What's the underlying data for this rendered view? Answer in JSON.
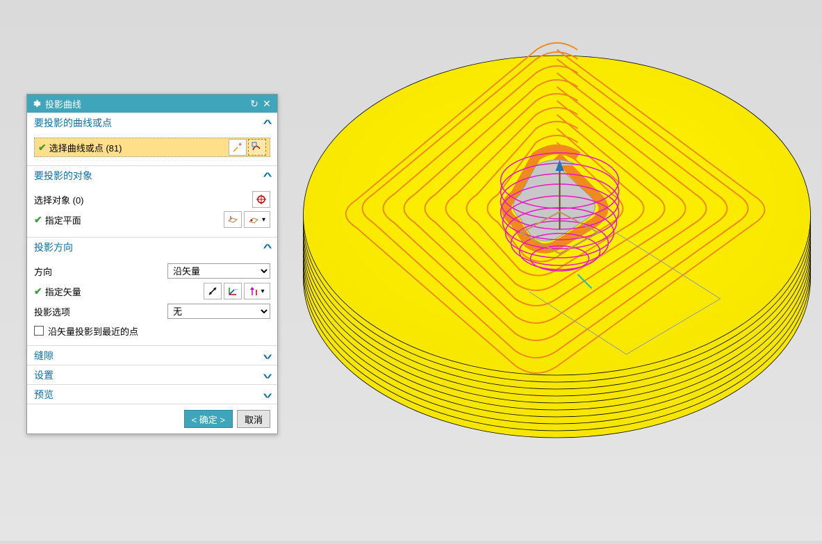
{
  "dialog": {
    "title": "投影曲线",
    "section1": {
      "header": "要投影的曲线或点",
      "select_curve_label": "选择曲线或点 (81)"
    },
    "section2": {
      "header": "要投影的对象",
      "select_obj_label": "选择对象 (0)",
      "specify_plane_label": "指定平面"
    },
    "section3": {
      "header": "投影方向",
      "direction_label": "方向",
      "direction_value": "沿矢量",
      "specify_vector_label": "指定矢量",
      "proj_option_label": "投影选项",
      "proj_option_value": "无",
      "checkbox_label": "沿矢量投影到最近的点"
    },
    "section4": {
      "header": "缝隙"
    },
    "section5": {
      "header": "设置"
    },
    "section6": {
      "header": "预览"
    },
    "footer": {
      "ok": "< 确定 >",
      "cancel": "取消"
    }
  }
}
